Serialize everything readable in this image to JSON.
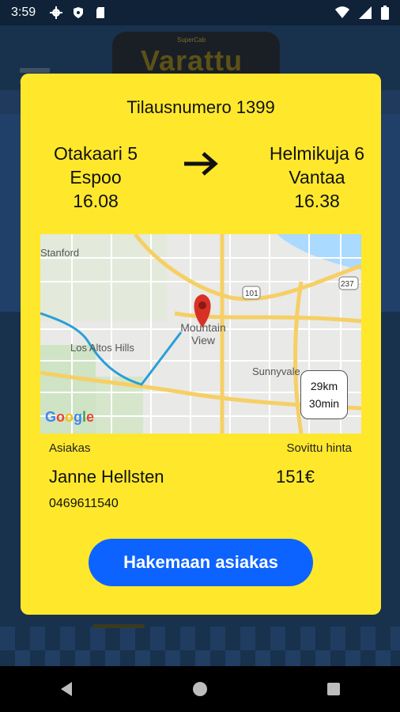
{
  "status_bar": {
    "time": "3:59",
    "icons": [
      "settings-icon",
      "shield-icon",
      "sd-card-icon",
      "wifi-icon",
      "signal-icon",
      "battery-icon"
    ]
  },
  "background": {
    "brand_small": "SuperCab",
    "brand_big": "Varattu"
  },
  "dialog": {
    "order_title": "Tilausnumero 1399",
    "from": {
      "street": "Otakaari 5",
      "city": "Espoo",
      "time": "16.08"
    },
    "to": {
      "street": "Helmikuja 6",
      "city": "Vantaa",
      "time": "16.38"
    },
    "arrow_icon": "arrow-right-icon",
    "map": {
      "labels": [
        "Stanford",
        "Mountain View",
        "Los Altos Hills",
        "Sunnyvale",
        "101",
        "237"
      ],
      "distance": "29km",
      "duration": "30min",
      "provider": "Google",
      "marker_icon": "map-pin-icon"
    },
    "customer_label": "Asiakas",
    "price_label": "Sovittu hinta",
    "customer_name": "Janne Hellsten",
    "price": "151€",
    "phone": "0469611540",
    "action_button": "Hakemaan asiakas"
  },
  "colors": {
    "dialog_bg": "#ffe82c",
    "button_bg": "#0d63ff",
    "route_line": "#2a9fd6",
    "marker": "#d93025"
  }
}
